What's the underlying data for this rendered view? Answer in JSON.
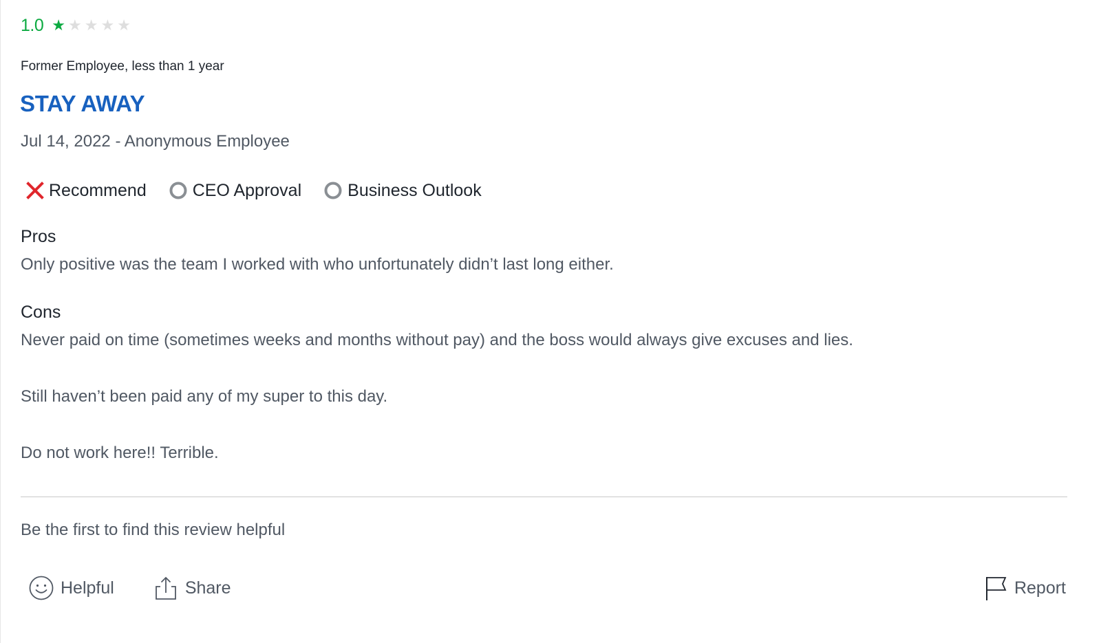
{
  "review": {
    "rating": "1.0",
    "stars_filled": 1,
    "stars_total": 5,
    "employment": "Former Employee, less than 1 year",
    "title": "STAY AWAY",
    "meta": "Jul 14, 2022 - Anonymous Employee",
    "indicators": [
      {
        "label": "Recommend",
        "status": "negative",
        "icon": "x-icon"
      },
      {
        "label": "CEO Approval",
        "status": "none",
        "icon": "circle-icon"
      },
      {
        "label": "Business Outlook",
        "status": "none",
        "icon": "circle-icon"
      }
    ],
    "pros": {
      "label": "Pros",
      "text": "Only positive was the team I worked with who unfortunately didn’t last long either."
    },
    "cons": {
      "label": "Cons",
      "paragraphs": [
        "Never paid on time (sometimes weeks and months without pay) and the boss would always give excuses and lies.",
        "Still haven’t been paid any of my super to this day.",
        "Do not work here!! Terrible."
      ]
    },
    "helpful_count_text": "Be the first to find this review helpful"
  },
  "actions": {
    "helpful": {
      "label": "Helpful",
      "icon": "smiley-icon"
    },
    "share": {
      "label": "Share",
      "icon": "share-icon"
    },
    "report": {
      "label": "Report",
      "icon": "flag-icon"
    }
  },
  "colors": {
    "rating_green": "#0caa41",
    "title_blue": "#1861bf",
    "negative_red": "#e0262c",
    "neutral_gray": "#8a8f94"
  }
}
